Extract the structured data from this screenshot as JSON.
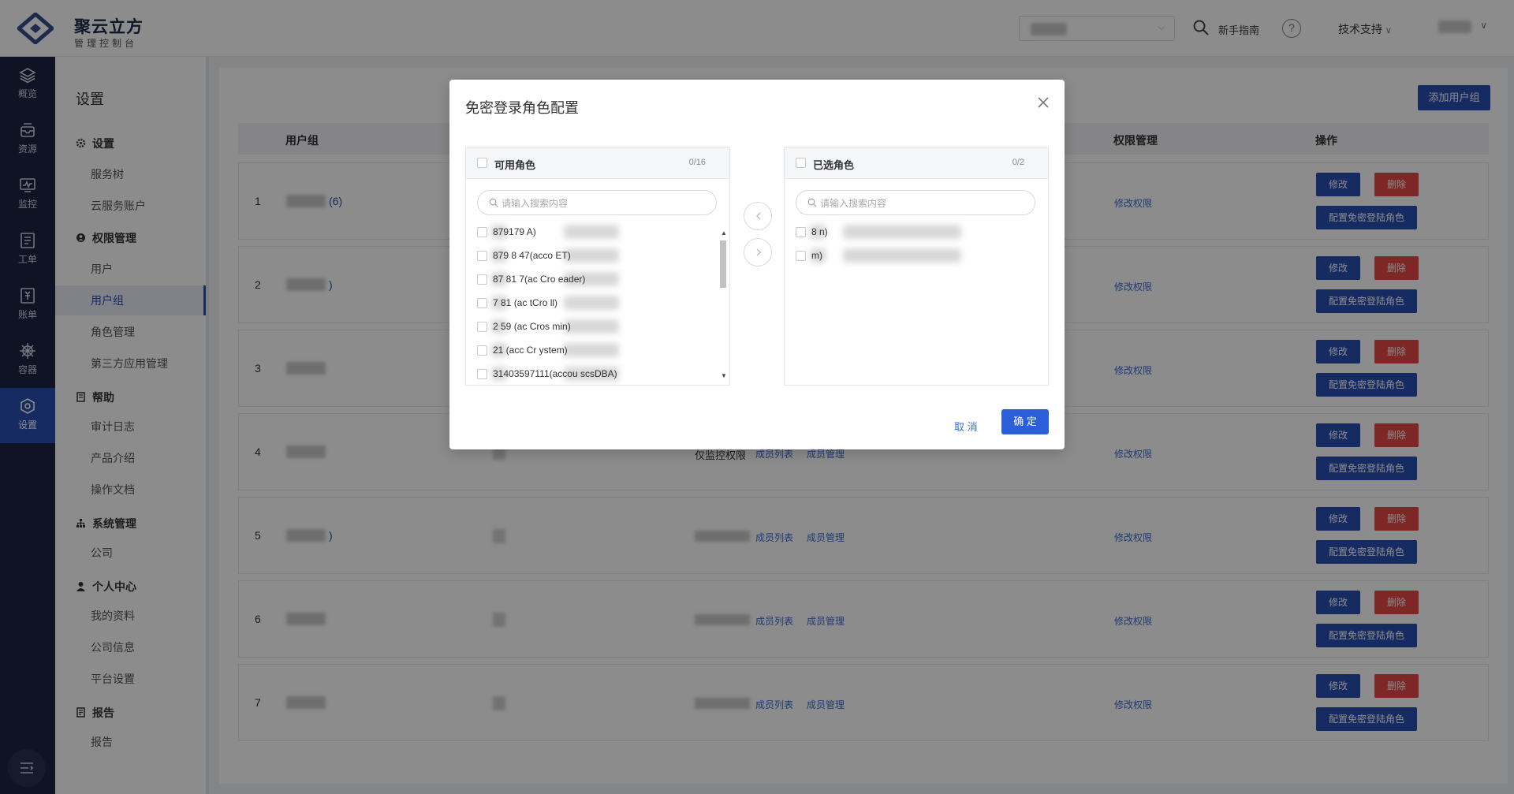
{
  "header": {
    "brand_title": "聚云立方",
    "brand_subtitle": "管理控制台",
    "guide": "新手指南",
    "help_icon": "?",
    "support": "技术支持"
  },
  "leftnav": {
    "items": [
      {
        "label": "概览",
        "icon": "layers-icon"
      },
      {
        "label": "资源",
        "icon": "inbox-icon"
      },
      {
        "label": "监控",
        "icon": "monitor-icon"
      },
      {
        "label": "工单",
        "icon": "ticket-icon"
      },
      {
        "label": "账单",
        "icon": "bill-icon"
      },
      {
        "label": "容器",
        "icon": "helm-icon"
      },
      {
        "label": "设置",
        "icon": "settings-icon",
        "active": true
      }
    ]
  },
  "submenu": {
    "title": "设置",
    "groups": [
      {
        "label": "设置",
        "items": [
          "服务树",
          "云服务账户"
        ]
      },
      {
        "label": "权限管理",
        "items": [
          "用户",
          "用户组",
          "角色管理",
          "第三方应用管理"
        ]
      },
      {
        "label": "帮助",
        "items": [
          "审计日志",
          "产品介绍",
          "操作文档"
        ]
      },
      {
        "label": "系统管理",
        "items": [
          "公司"
        ]
      },
      {
        "label": "个人中心",
        "items": [
          "我的资料",
          "公司信息",
          "平台设置"
        ]
      },
      {
        "label": "报告",
        "items": [
          "报告"
        ]
      }
    ],
    "active_item": "用户组"
  },
  "main": {
    "add_button": "添加用户组",
    "columns": [
      "用户组",
      "权限管理",
      "操作"
    ],
    "rows": [
      {
        "index": "1",
        "name_suffix": "(6)",
        "c3": "",
        "links": []
      },
      {
        "index": "2",
        "name_suffix": ")",
        "c3": "",
        "links": []
      },
      {
        "index": "3",
        "name_suffix": "",
        "c3": "",
        "links": []
      },
      {
        "index": "4",
        "name_suffix": "",
        "c3": "仅监控权限",
        "links": [
          "成员列表",
          "成员管理"
        ]
      },
      {
        "index": "5",
        "name_suffix": ")",
        "c3": "",
        "links": [
          "成员列表",
          "成员管理"
        ]
      },
      {
        "index": "6",
        "name_suffix": "",
        "c3": "",
        "links": [
          "成员列表",
          "成员管理"
        ]
      },
      {
        "index": "7",
        "name_suffix": "",
        "c3": "",
        "links": [
          "成员列表",
          "成员管理"
        ]
      }
    ],
    "perm_link": "修改权限",
    "edit": "修改",
    "delete": "删除",
    "config": "配置免密登陆角色"
  },
  "modal": {
    "title": "免密登录角色配置",
    "left": {
      "title": "可用角色",
      "count": "0/16",
      "placeholder": "请输入搜索内容",
      "items": [
        "879179             A)",
        "879  8  47(acco     ET)",
        "87   81  7(ac   Cro   eader)",
        "  7   81  (ac   tCro   ll)",
        "  2   59   (ac   Cros   min)",
        "  21       (acc    Cr   ystem)",
        "  31403597111(accou    scsDBA)"
      ]
    },
    "right": {
      "title": "已选角色",
      "count": "0/2",
      "placeholder": "请输入搜索内容",
      "items": [
        "8                  n)",
        "                     m)"
      ]
    },
    "cancel": "取 消",
    "ok": "确 定"
  },
  "colors": {
    "primary": "#2b4fb4",
    "danger": "#e34848",
    "sidebar": "#1e2440"
  }
}
